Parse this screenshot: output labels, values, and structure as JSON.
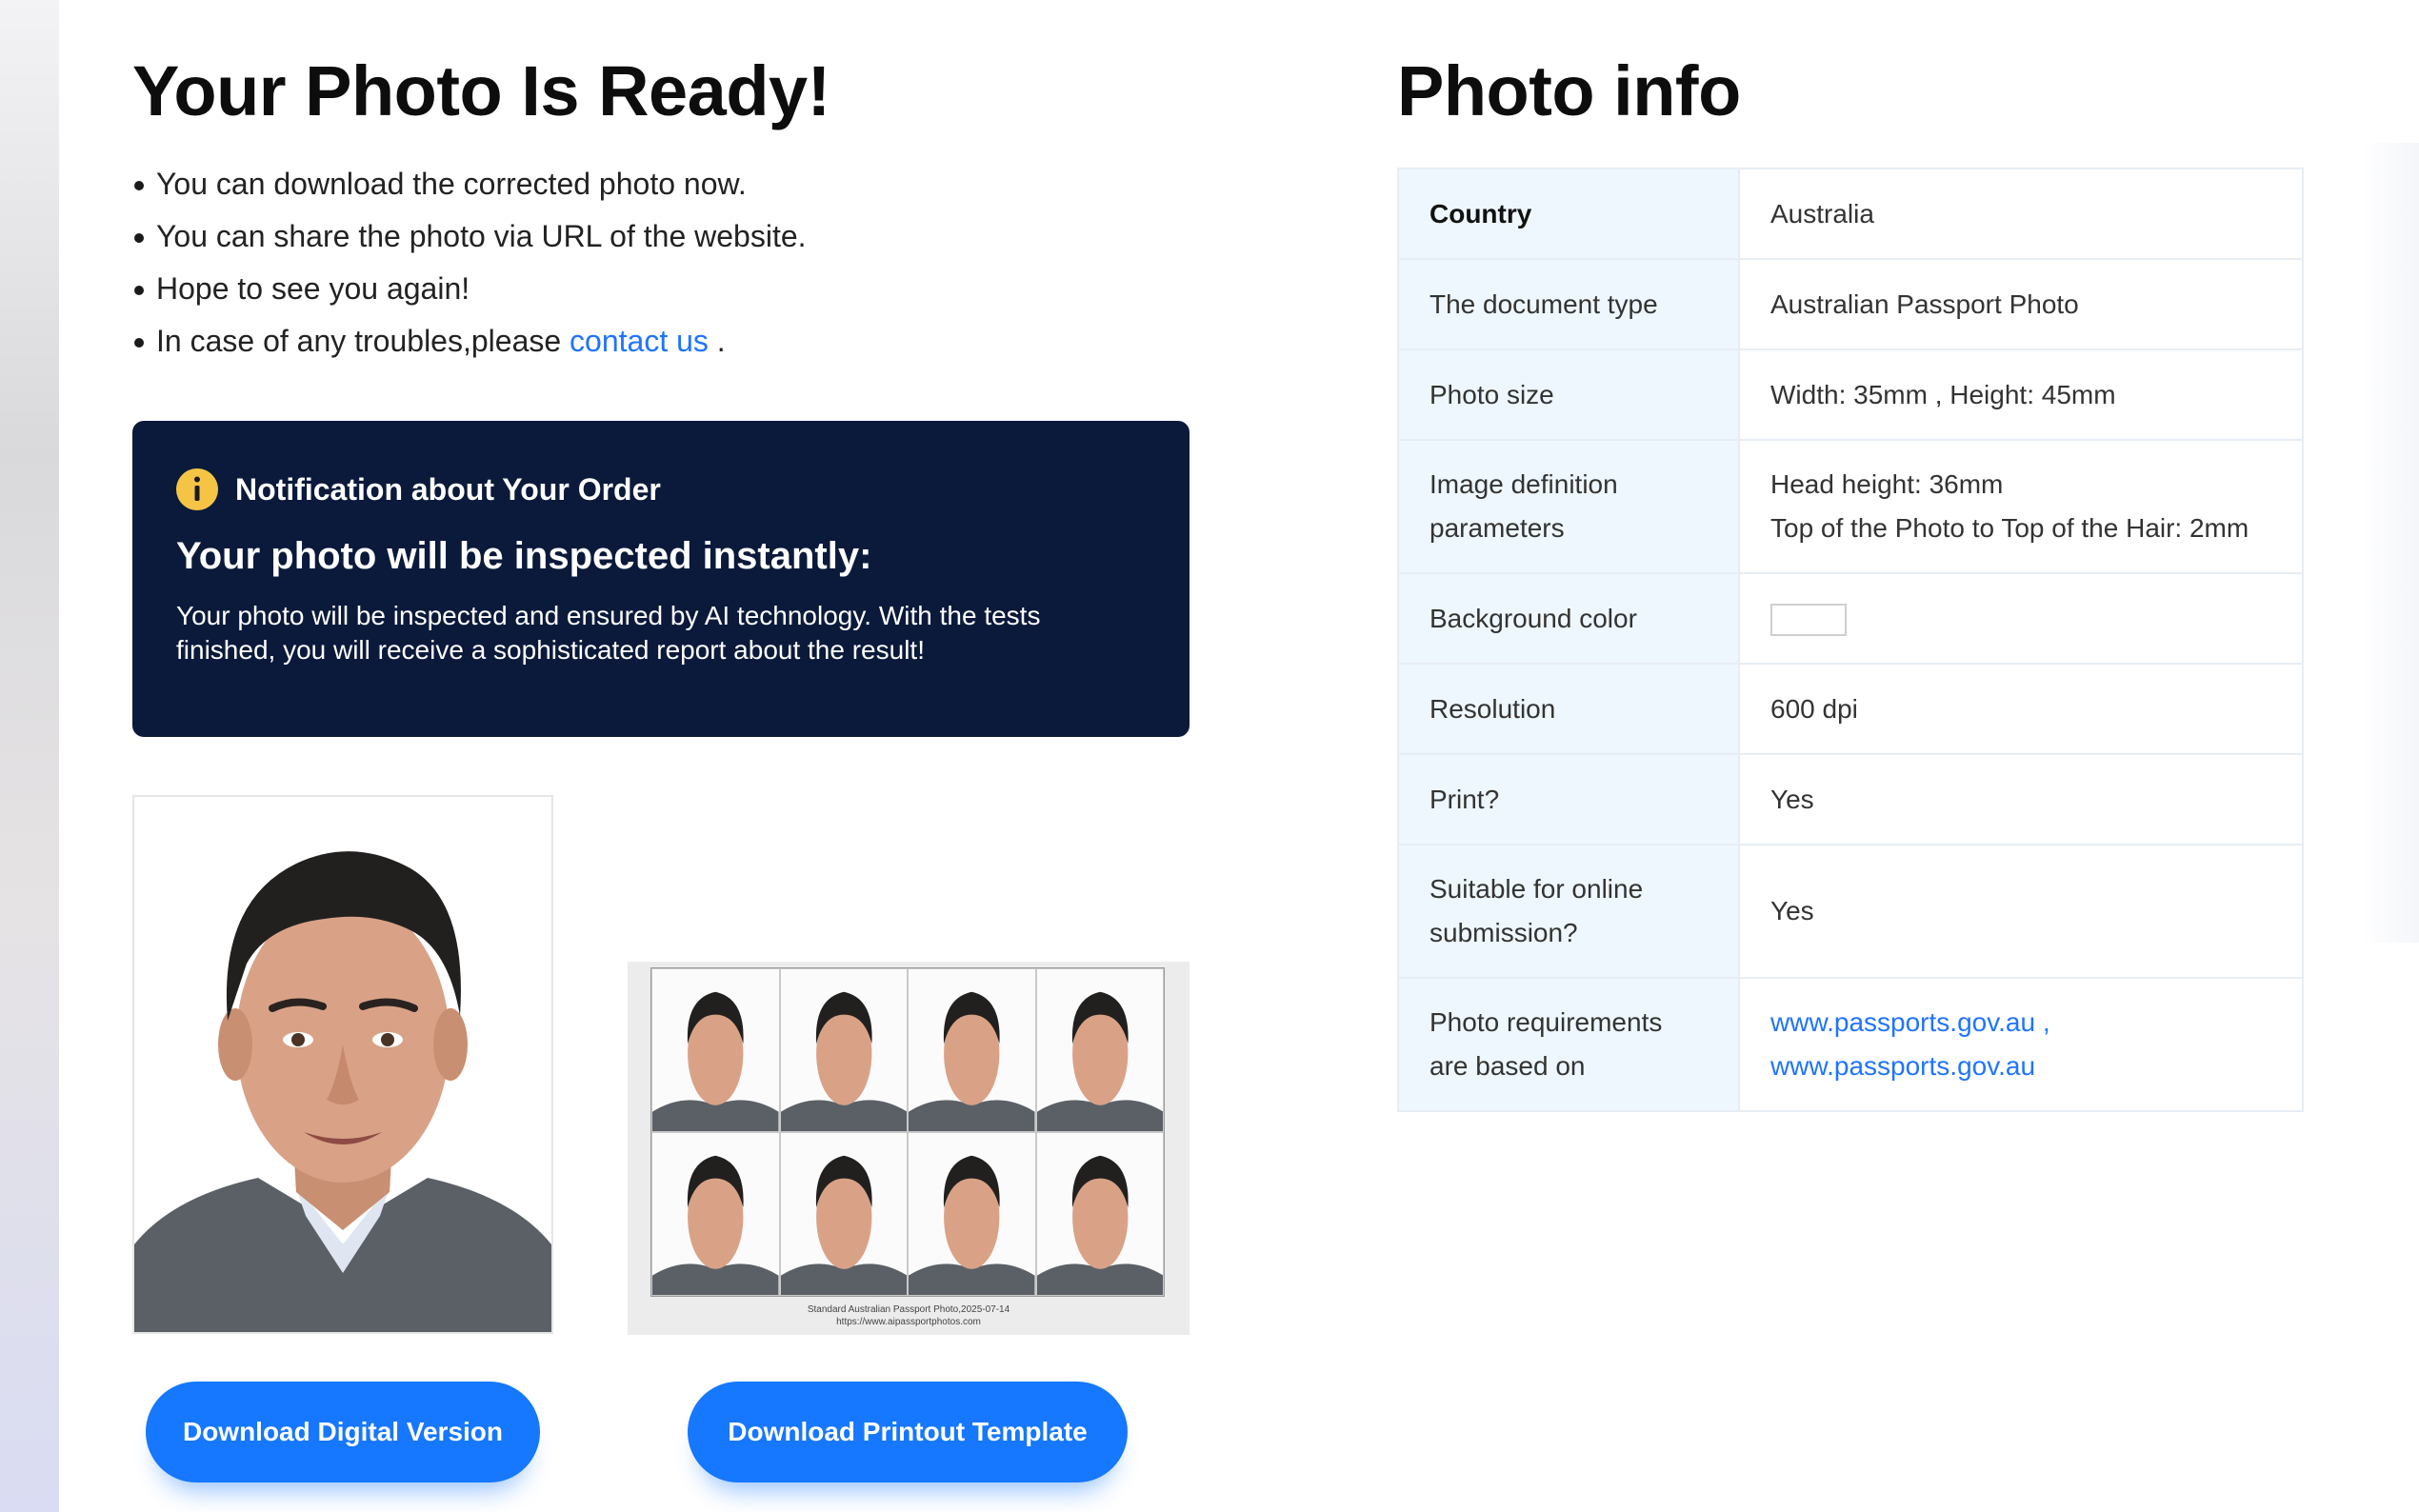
{
  "left": {
    "title": "Your Photo Is Ready!",
    "bullets": [
      "You can download the corrected photo now.",
      "You can share the photo via URL of the website.",
      "Hope to see you again!"
    ],
    "trouble_prefix": "In case of any troubles,please ",
    "contact_link": "contact us",
    "trouble_suffix": " ."
  },
  "notice": {
    "icon": "info-icon",
    "label": "Notification about Your Order",
    "title": "Your photo will be inspected instantly:",
    "body": "Your photo will be inspected and ensured by AI technology. With the tests finished, you will receive a sophisticated report about the result!"
  },
  "sheet": {
    "caption_line1": "Standard Australian Passport Photo,2025-07-14",
    "caption_line2": "https://www.aipassportphotos.com"
  },
  "buttons": {
    "digital": "Download Digital Version",
    "printout": "Download Printout Template"
  },
  "photo_info": {
    "title": "Photo info",
    "rows": [
      {
        "key": "Country",
        "value": "Australia"
      },
      {
        "key": "The document type",
        "value": "Australian Passport Photo"
      },
      {
        "key": "Photo size",
        "value": "Width: 35mm , Height: 45mm"
      },
      {
        "key": "Image definition parameters",
        "value_line1": "Head height: 36mm",
        "value_line2": "Top of the Photo to Top of the Hair: 2mm"
      },
      {
        "key": "Background color",
        "swatch_color": "#ffffff"
      },
      {
        "key": "Resolution",
        "value": "600 dpi"
      },
      {
        "key": "Print?",
        "value": "Yes"
      },
      {
        "key": "Suitable for online submission?",
        "value": "Yes"
      },
      {
        "key": "Photo requirements are based on",
        "link1": "www.passports.gov.au ,",
        "link2": "www.passports.gov.au"
      }
    ]
  },
  "colors": {
    "accent": "#1677ff",
    "link": "#1f74ff",
    "notice_bg": "#0b1a3b",
    "info_icon": "#f6c445",
    "table_key_bg": "#eef7fd"
  }
}
